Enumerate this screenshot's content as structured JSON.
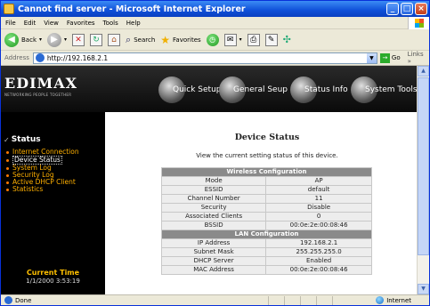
{
  "window": {
    "title": "Cannot find server - Microsoft Internet Explorer",
    "min_glyph": "_",
    "max_glyph": "□",
    "close_glyph": "×"
  },
  "menu": [
    "File",
    "Edit",
    "View",
    "Favorites",
    "Tools",
    "Help"
  ],
  "toolbar": {
    "back_label": "Back",
    "search_label": "Search",
    "favorites_label": "Favorites"
  },
  "address": {
    "label": "Address",
    "url": "http://192.168.2.1",
    "go_label": "Go",
    "links_label": "Links »"
  },
  "banner": {
    "logo": "EDIMAX",
    "tagline": "NETWORKING PEOPLE TOGETHER",
    "nav": [
      "Quick Setup",
      "General Seup",
      "Status Info",
      "System Tools"
    ]
  },
  "sidebar": {
    "title": "Status",
    "items": [
      "Internet Connection",
      "Device Status",
      "System Log",
      "Security Log",
      "Active DHCP Client",
      "Statistics"
    ],
    "active_index": 1,
    "current_time_label": "Current Time",
    "current_time_value": "1/1/2000 3:53:19"
  },
  "main": {
    "title": "Device Status",
    "description": "View the current setting status of this device.",
    "wireless_header": "Wireless Configuration",
    "wireless_rows": [
      {
        "label": "Mode",
        "value": "AP"
      },
      {
        "label": "ESSID",
        "value": "default"
      },
      {
        "label": "Channel Number",
        "value": "11"
      },
      {
        "label": "Security",
        "value": "Disable"
      },
      {
        "label": "Associated Clients",
        "value": "0"
      },
      {
        "label": "BSSID",
        "value": "00:0e:2e:00:08:46"
      }
    ],
    "lan_header": "LAN Configuration",
    "lan_rows": [
      {
        "label": "IP Address",
        "value": "192.168.2.1"
      },
      {
        "label": "Subnet Mask",
        "value": "255.255.255.0"
      },
      {
        "label": "DHCP Server",
        "value": "Enabled"
      },
      {
        "label": "MAC Address",
        "value": "00:0e:2e:00:08:46"
      }
    ]
  },
  "statusbar": {
    "text": "Done",
    "zone": "Internet"
  }
}
